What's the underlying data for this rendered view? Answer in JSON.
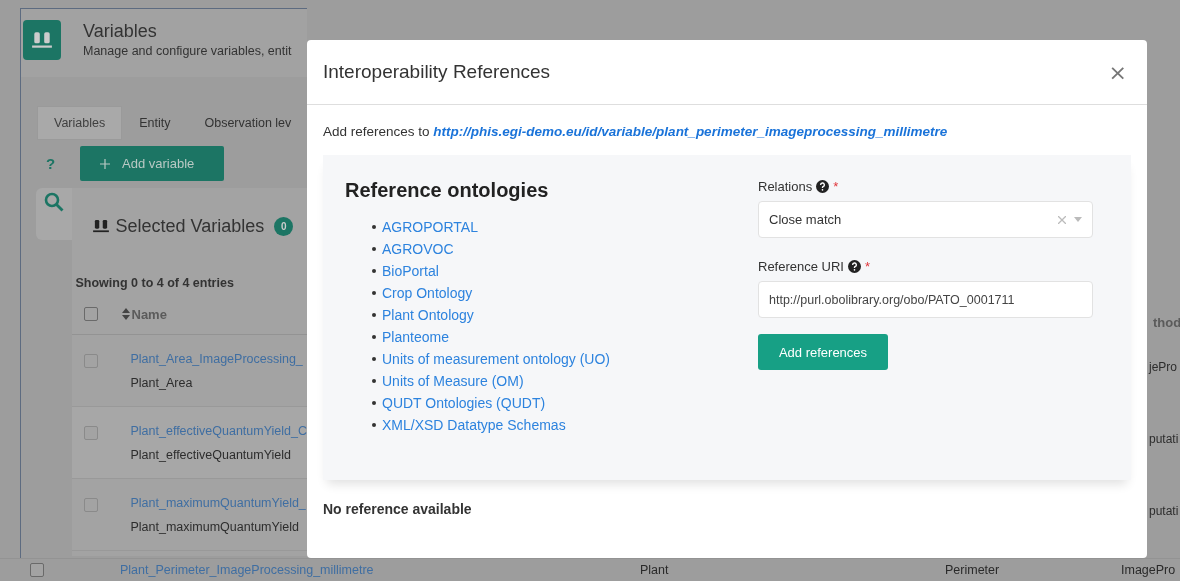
{
  "page": {
    "title": "Variables",
    "subtitle": "Manage and configure variables, entit",
    "tabs": [
      {
        "label": "Variables",
        "selected": true
      },
      {
        "label": "Entity",
        "selected": false
      },
      {
        "label": "Observation lev",
        "selected": false
      }
    ],
    "help": "?",
    "add_button": "Add variable",
    "card_title": "Selected Variables",
    "selected_count": "0",
    "entries_info": "Showing 0 to 4 of 4 entries"
  },
  "table": {
    "header_checked": false,
    "columns": [
      {
        "label": "Name"
      },
      {
        "label": "thod"
      }
    ],
    "rows": [
      {
        "checked": false,
        "link": "Plant_Area_ImageProcessing_",
        "name": "Plant_Area",
        "column_right": "jePro"
      },
      {
        "checked": false,
        "link": "Plant_effectiveQuantumYield_C",
        "name": "Plant_effectiveQuantumYield",
        "column_right": "putati"
      },
      {
        "checked": false,
        "link": "Plant_maximumQuantumYield_",
        "name": "Plant_maximumQuantumYield",
        "column_right": "putati"
      }
    ],
    "last_row": {
      "checked": false,
      "link": "Plant_Perimeter_ImageProcessing_millimetre",
      "column_2": "Plant",
      "column_3": "Perimeter",
      "column_4": "ImagePro"
    }
  },
  "modal": {
    "title": "Interoperability References",
    "close": "×",
    "intro": "Add references to",
    "target": "http://phis.egi-demo.eu/id/variable/plant_perimeter_imageprocessing_millimetre",
    "ontologies_title": "Reference ontologies",
    "ontologies": [
      "AGROPORTAL",
      "AGROVOC",
      "BioPortal",
      "Crop Ontology",
      "Plant Ontology",
      "Planteome",
      "Units of measurement ontology (UO)",
      "Units of Measure (OM)",
      "QUDT Ontologies (QUDT)",
      "XML/XSD Datatype Schemas"
    ],
    "required_mark": "*",
    "relations_label": "Relations",
    "relations_value": "Close match",
    "uri_label": "Reference URI",
    "uri_value": "http://purl.obolibrary.org/obo/PATO_0001711",
    "add_button": "Add references",
    "empty_text": "No reference available"
  }
}
